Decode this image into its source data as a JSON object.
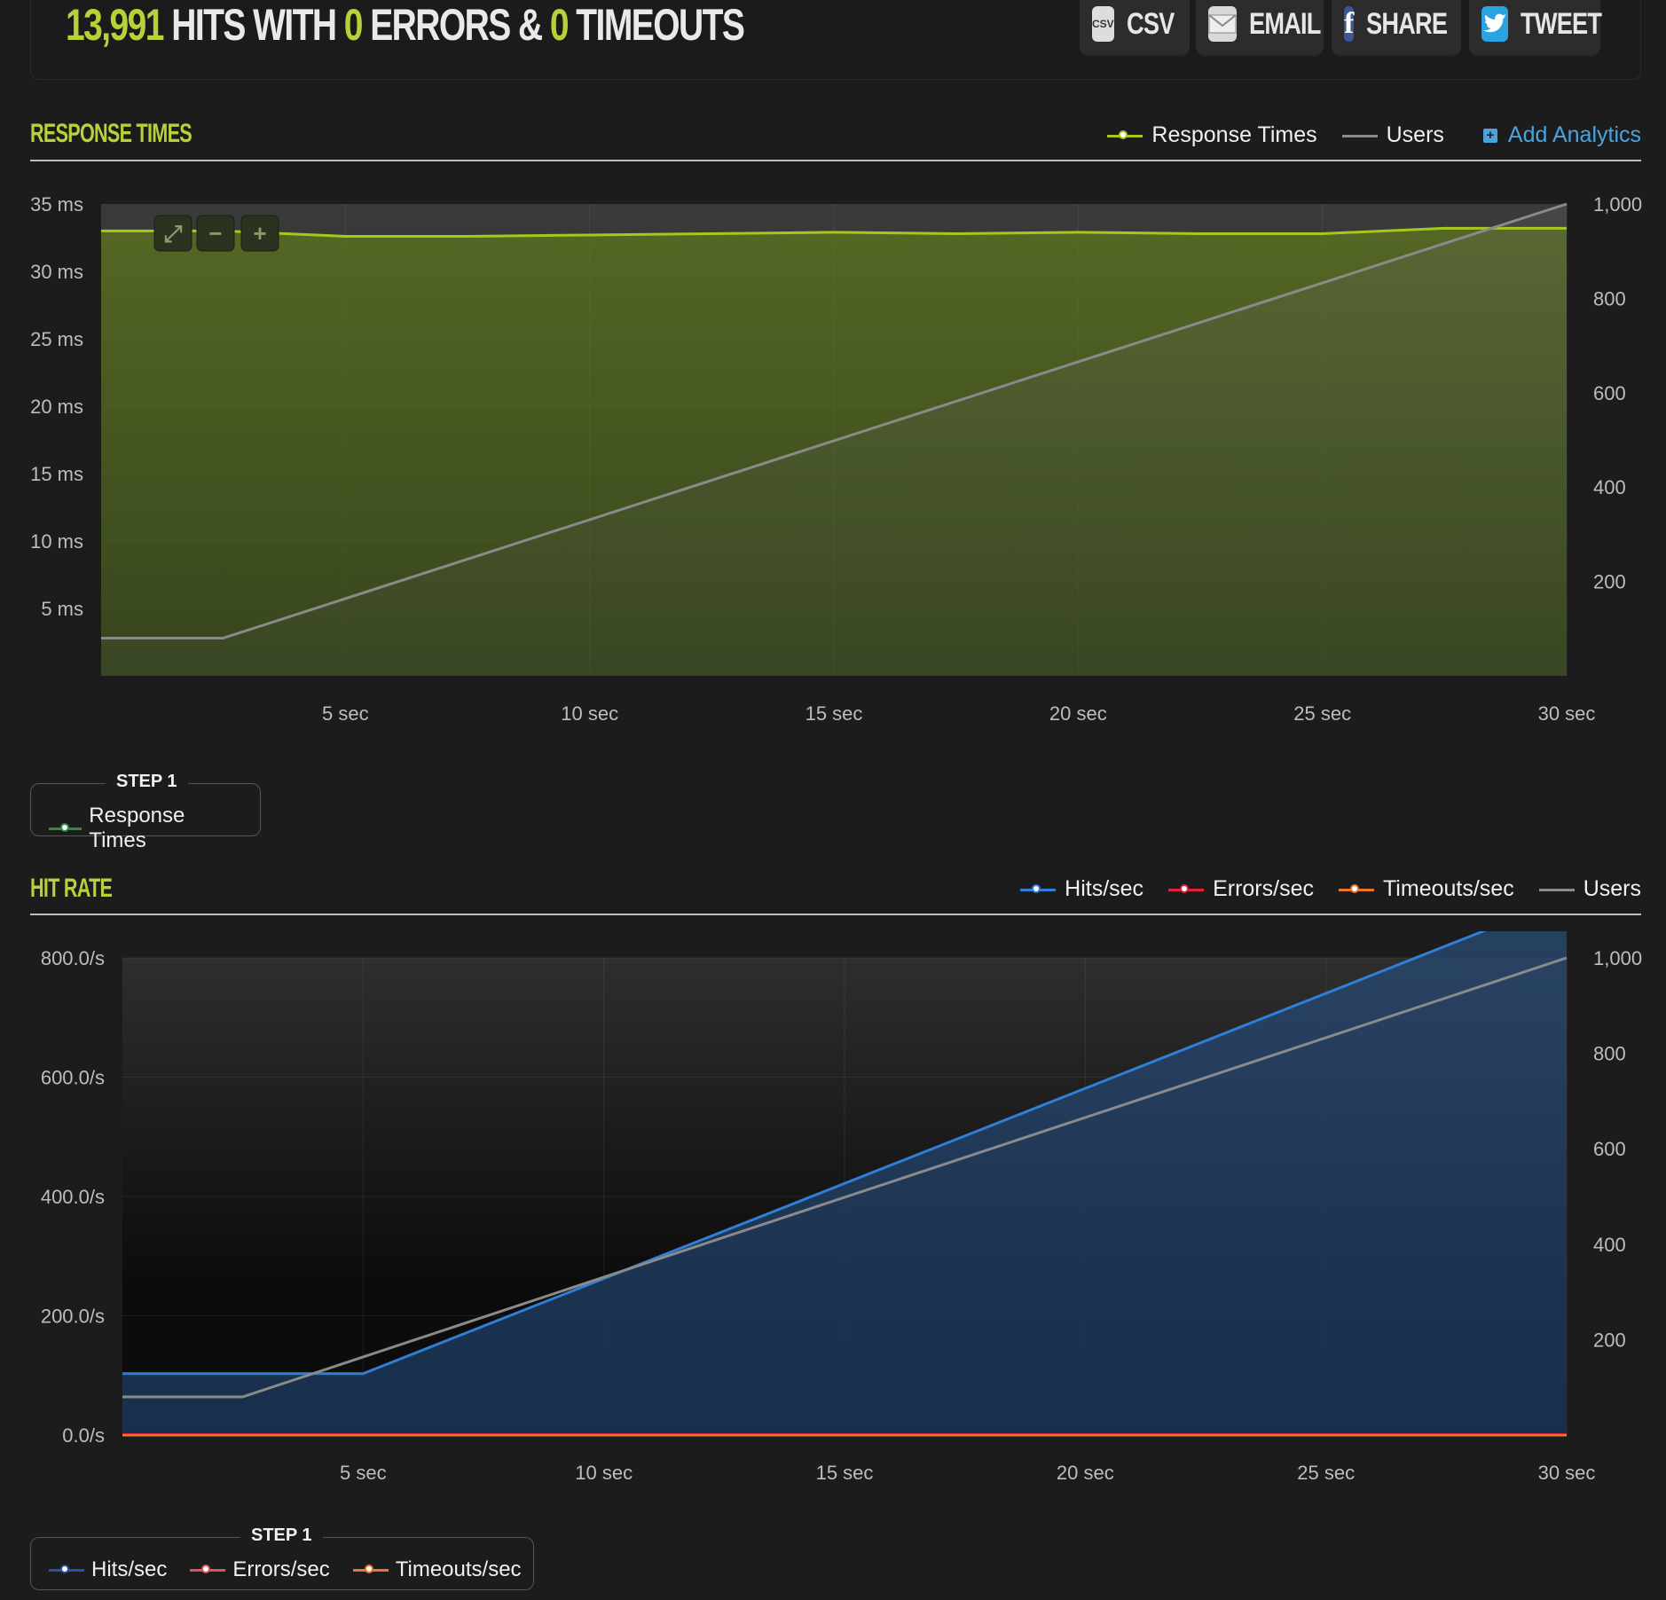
{
  "header": {
    "hits": "13,991",
    "hits_with": "HITS WITH",
    "errors": "0",
    "errors_label": "ERRORS &",
    "timeouts": "0",
    "timeouts_label": "TIMEOUTS",
    "buttons": [
      {
        "label": "CSV",
        "icon": "csv-icon"
      },
      {
        "label": "EMAIL",
        "icon": "envelope-icon"
      },
      {
        "label": "SHARE",
        "icon": "facebook-icon"
      },
      {
        "label": "TWEET",
        "icon": "twitter-icon"
      }
    ]
  },
  "response_section": {
    "title": "RESPONSE TIMES",
    "legend": [
      {
        "label": "Response Times",
        "color": "#a4c91c",
        "marker": true
      },
      {
        "label": "Users",
        "color": "#8a8a8a",
        "marker": false
      }
    ],
    "add_analytics": "Add Analytics",
    "zoom_controls": [
      "expand-icon",
      "zoom-out-icon",
      "zoom-in-icon"
    ],
    "step": {
      "title": "STEP 1",
      "items": [
        {
          "label": "Response Times",
          "color": "#2e8b3e"
        }
      ]
    }
  },
  "hit_section": {
    "title": "HIT RATE",
    "legend": [
      {
        "label": "Hits/sec",
        "color": "#2f7fd6",
        "marker": true
      },
      {
        "label": "Errors/sec",
        "color": "#e0213a",
        "marker": true
      },
      {
        "label": "Timeouts/sec",
        "color": "#e8752a",
        "marker": true
      },
      {
        "label": "Users",
        "color": "#8a8a8a",
        "marker": false
      }
    ],
    "step": {
      "title": "STEP 1",
      "items": [
        {
          "label": "Hits/sec",
          "color": "#2b4fa8"
        },
        {
          "label": "Errors/sec",
          "color": "#d9535f"
        },
        {
          "label": "Timeouts/sec",
          "color": "#e8752a"
        }
      ]
    }
  },
  "chart_data": [
    {
      "type": "area",
      "x": [
        0,
        5,
        10,
        15,
        20,
        25,
        30
      ],
      "x_tick_labels": [
        "5 sec",
        "10 sec",
        "15 sec",
        "20 sec",
        "25 sec",
        "30 sec"
      ],
      "y_tick_labels": [
        "5 ms",
        "10 ms",
        "15 ms",
        "20 ms",
        "25 ms",
        "30 ms",
        "35 ms"
      ],
      "y2_tick_labels": [
        "200",
        "400",
        "600",
        "800",
        "1,000"
      ],
      "ylim": [
        0,
        35
      ],
      "y2lim": [
        0,
        1000
      ],
      "series": [
        {
          "name": "Response Times",
          "axis": "left",
          "x": [
            0,
            2.5,
            5,
            7.5,
            10,
            12.5,
            15,
            17.5,
            20,
            22.5,
            25,
            27.5,
            30
          ],
          "values": [
            33,
            33,
            32.6,
            32.6,
            32.7,
            32.8,
            32.9,
            32.8,
            32.9,
            32.8,
            32.8,
            33.2,
            33.2
          ]
        },
        {
          "name": "Users",
          "axis": "right",
          "x": [
            0,
            2.5,
            30
          ],
          "values": [
            80,
            80,
            1000
          ]
        }
      ],
      "grid": true
    },
    {
      "type": "area",
      "x": [
        0,
        5,
        10,
        15,
        20,
        25,
        30
      ],
      "x_tick_labels": [
        "5 sec",
        "10 sec",
        "15 sec",
        "20 sec",
        "25 sec",
        "30 sec"
      ],
      "y_tick_labels": [
        "0.0/s",
        "200.0/s",
        "400.0/s",
        "600.0/s",
        "800.0/s"
      ],
      "y2_tick_labels": [
        "200",
        "400",
        "600",
        "800",
        "1,000"
      ],
      "ylim": [
        0,
        800
      ],
      "y2lim": [
        0,
        1000
      ],
      "series": [
        {
          "name": "Hits/sec",
          "axis": "left",
          "x": [
            0,
            5,
            30
          ],
          "values": [
            103,
            103,
            900
          ]
        },
        {
          "name": "Errors/sec",
          "axis": "left",
          "x": [
            0,
            30
          ],
          "values": [
            0,
            0
          ]
        },
        {
          "name": "Timeouts/sec",
          "axis": "left",
          "x": [
            0,
            30
          ],
          "values": [
            0,
            0
          ]
        },
        {
          "name": "Users",
          "axis": "right",
          "x": [
            0,
            2.5,
            30
          ],
          "values": [
            80,
            80,
            1000
          ]
        }
      ],
      "grid": true
    }
  ]
}
